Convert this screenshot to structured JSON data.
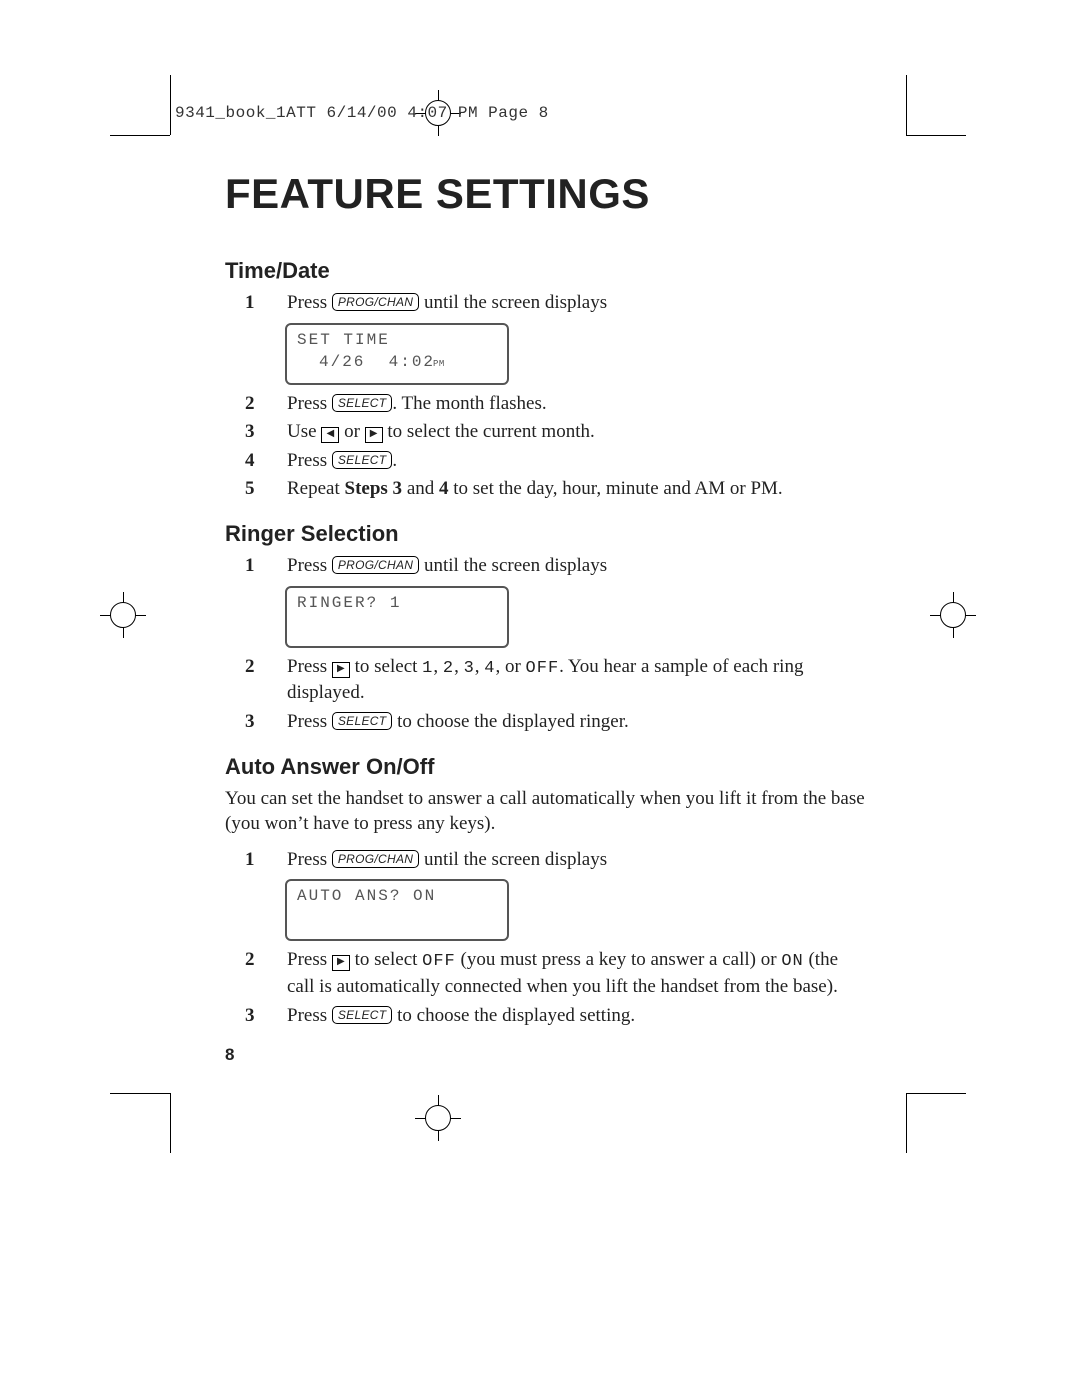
{
  "slug": "9341_book_1ATT  6/14/00  4:07 PM  Page 8",
  "title": "FEATURE SETTINGS",
  "keys": {
    "prog_chan": "PROG/CHAN",
    "select": "SELECT"
  },
  "arrows": {
    "left": "◀",
    "right": "▶"
  },
  "sections": {
    "timeDate": {
      "heading": "Time/Date",
      "step1_a": "Press ",
      "step1_b": " until the screen displays",
      "lcd_line1": "SET TIME",
      "lcd_line2_a": "4/26",
      "lcd_line2_b": "4:02",
      "lcd_line2_pm": "PM",
      "step2_a": "Press ",
      "step2_b": ". The month flashes.",
      "step3_a": "Use ",
      "step3_mid": " or ",
      "step3_b": " to select the current month.",
      "step4_a": "Press ",
      "step4_b": ".",
      "step5_a": "Repeat ",
      "step5_bold1": "Steps 3",
      "step5_mid": " and ",
      "step5_bold2": "4",
      "step5_b": " to set the day, hour, minute and AM or PM."
    },
    "ringer": {
      "heading": "Ringer Selection",
      "step1_a": "Press ",
      "step1_b": " until the screen displays",
      "lcd_line1": "RINGER?  1",
      "step2_a": "Press ",
      "step2_mid": " to select ",
      "step2_opts_1": "1",
      "step2_c1": ", ",
      "step2_opts_2": "2",
      "step2_c2": ", ",
      "step2_opts_3": "3",
      "step2_c3": ", ",
      "step2_opts_4": "4",
      "step2_c4": ", or ",
      "step2_off": "OFF",
      "step2_b": ". You hear a sample of each ring displayed.",
      "step3_a": "Press ",
      "step3_b": " to choose the displayed ringer."
    },
    "autoAns": {
      "heading": "Auto Answer On/Off",
      "intro": "You can set the handset to answer a call automatically when you lift it from the base (you won’t have to press any keys).",
      "step1_a": "Press ",
      "step1_b": " until the screen displays",
      "lcd_line1": "AUTO ANS?  ON",
      "step2_a": "Press ",
      "step2_mid": " to select ",
      "step2_off": "OFF",
      "step2_txt1": " (you must press a key to answer a call) or ",
      "step2_on": "ON",
      "step2_txt2": " (the call is automatically connected when you lift the handset from the base).",
      "step3_a": "Press ",
      "step3_b": " to choose the displayed setting."
    }
  },
  "pageNumber": "8"
}
